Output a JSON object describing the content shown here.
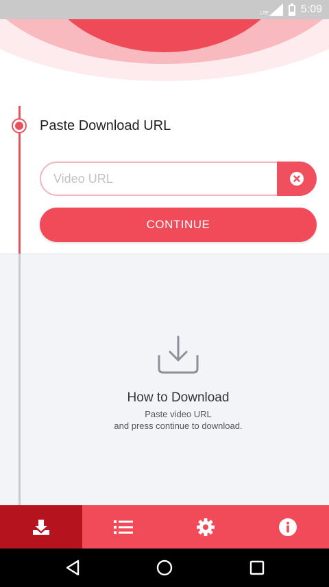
{
  "status_bar": {
    "network": "LTE",
    "time": "5:09"
  },
  "step": {
    "title": "Paste Download URL",
    "url_placeholder": "Video URL",
    "url_value": "",
    "continue_label": "CONTINUE"
  },
  "info": {
    "title": "How to Download",
    "line1": "Paste video URL",
    "line2": "and press continue to download."
  },
  "tabs": [
    {
      "icon": "download-icon",
      "active": true
    },
    {
      "icon": "list-icon",
      "active": false
    },
    {
      "icon": "gear-icon",
      "active": false
    },
    {
      "icon": "info-icon",
      "active": false
    }
  ],
  "colors": {
    "accent": "#f14a59",
    "accent_dark": "#b5131d",
    "wave_light": "#fde4e6",
    "wave_mid": "#f8b7bd",
    "wave_core": "#ef4a58"
  }
}
